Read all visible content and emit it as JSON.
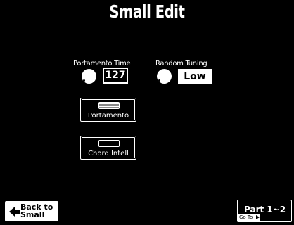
{
  "screen": {
    "title": "Small  Edit"
  },
  "parameters": {
    "portamento_time": {
      "label": "Portamento Time",
      "value": "127"
    },
    "random_tuning": {
      "label": "Random Tuning",
      "value": "Low"
    }
  },
  "toggles": {
    "portamento": {
      "label": "Portamento",
      "state": "on"
    },
    "chord_intell": {
      "label": "Chord Intell",
      "state": "off"
    }
  },
  "footer": {
    "back_button": {
      "line1": "Back to",
      "line2": "Small",
      "icon": "left-arrow-icon"
    },
    "part_button": {
      "label": "Part 1~2",
      "goto_label": "Go To"
    }
  },
  "colors": {
    "background": "#000000",
    "foreground": "#ffffff"
  }
}
